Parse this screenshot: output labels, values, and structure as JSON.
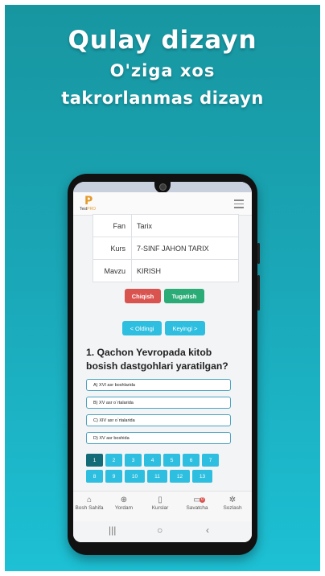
{
  "headline": {
    "line1": "Qulay dizayn",
    "line2": "O'ziga xos",
    "line3": "takrorlanmas dizayn"
  },
  "app": {
    "logo_letter": "P",
    "logo_text_a": "Test",
    "logo_text_b": "PRO",
    "menu_icon": "hamburger-icon"
  },
  "info_table": [
    {
      "key": "Fan",
      "value": "Tarix"
    },
    {
      "key": "Kurs",
      "value": "7-SINF JAHON TARIX"
    },
    {
      "key": "Mavzu",
      "value": "KIRISH"
    }
  ],
  "actions": {
    "exit_label": "Chiqish",
    "finish_label": "Tugatish",
    "prev_label": "< Oldingi",
    "next_label": "Keyingi >"
  },
  "question": {
    "text": "1. Qachon Yevropada kitob bosish dastgohlari yaratilgan?",
    "options": [
      "A) XVI asr boshlarida",
      "B) XV asr o`rtalarida",
      "C) XIV asr o`rtalarida",
      "D) XV asr boshida"
    ]
  },
  "pagination": {
    "pages": [
      "1",
      "2",
      "3",
      "4",
      "5",
      "6",
      "7",
      "8",
      "9",
      "10",
      "11",
      "12",
      "13"
    ],
    "active": "1"
  },
  "bottom_nav": [
    {
      "label": "Bosh Sahifa",
      "icon": "home-icon"
    },
    {
      "label": "Yordam",
      "icon": "lifebuoy-icon"
    },
    {
      "label": "Kurslar",
      "icon": "book-icon"
    },
    {
      "label": "Savatcha",
      "icon": "cart-icon",
      "badge": "0"
    },
    {
      "label": "Sozlash",
      "icon": "gear-icon"
    }
  ],
  "colors": {
    "accent": "#2ebfe0",
    "exit": "#d9534f",
    "finish": "#2bab76",
    "active_page": "#136b78"
  }
}
